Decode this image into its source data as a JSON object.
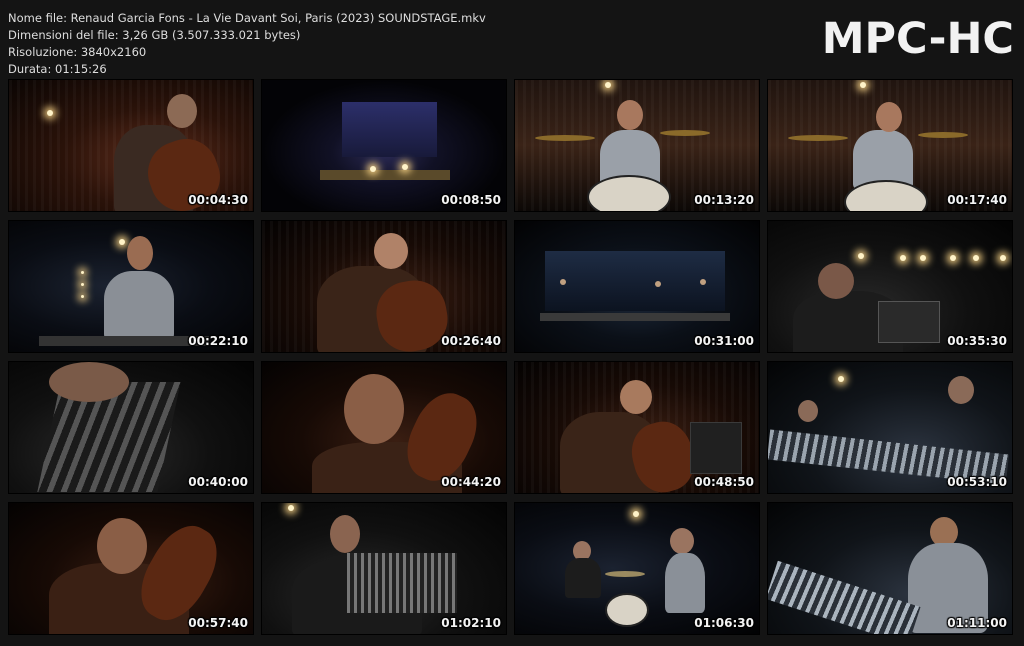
{
  "info": {
    "filename": "Nome file: Renaud Garcia Fons - La Vie Davant Soi, Paris (2023) SOUNDSTAGE.mkv",
    "filesize": "Dimensioni del file: 3,26 GB (3.507.333.021 bytes)",
    "resolution": "Risoluzione: 3840x2160",
    "duration": "Durata: 01:15:26"
  },
  "logo": "MPC-HC",
  "thumbnails": [
    {
      "time": "00:04:30",
      "scene": "cello-closeup"
    },
    {
      "time": "00:08:50",
      "scene": "stage-wide"
    },
    {
      "time": "00:13:20",
      "scene": "drummer"
    },
    {
      "time": "00:17:40",
      "scene": "drummer"
    },
    {
      "time": "00:22:10",
      "scene": "vibraphone"
    },
    {
      "time": "00:26:40",
      "scene": "cello-player"
    },
    {
      "time": "00:31:00",
      "scene": "stage-wide"
    },
    {
      "time": "00:35:30",
      "scene": "accordion-player"
    },
    {
      "time": "00:40:00",
      "scene": "accordion-keys"
    },
    {
      "time": "00:44:20",
      "scene": "cello-face"
    },
    {
      "time": "00:48:50",
      "scene": "cello-player"
    },
    {
      "time": "00:53:10",
      "scene": "vibraphone-wide"
    },
    {
      "time": "00:57:40",
      "scene": "cello-face"
    },
    {
      "time": "01:02:10",
      "scene": "accordion-player"
    },
    {
      "time": "01:06:30",
      "scene": "stage-trio"
    },
    {
      "time": "01:11:00",
      "scene": "vibraphone-player"
    }
  ]
}
